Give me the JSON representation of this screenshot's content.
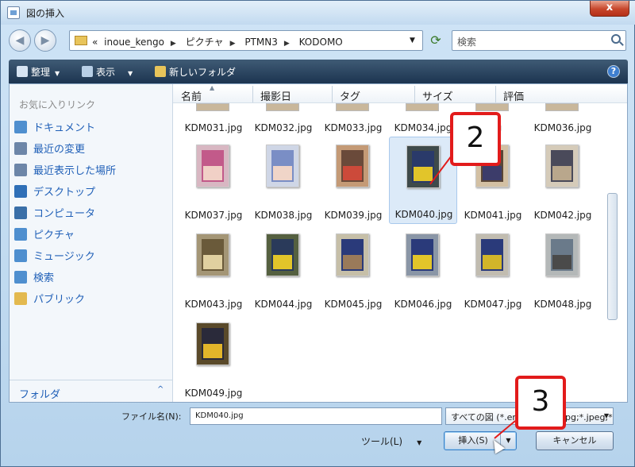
{
  "window": {
    "title": "図の挿入",
    "close_label": "x"
  },
  "address": {
    "crumbs": [
      "«",
      "inoue_kengo",
      "ピクチャ",
      "PTMN3",
      "KODOMO"
    ],
    "search_placeholder": "検索"
  },
  "toolbar": {
    "organize": "整理",
    "views": "表示",
    "new_folder": "新しいフォルダ",
    "help": "?"
  },
  "sidebar": {
    "favorites_header": "お気に入りリンク",
    "items": [
      {
        "label": "ドキュメント",
        "icon": "documents-icon",
        "color": "#4f8fcf"
      },
      {
        "label": "最近の変更",
        "icon": "recent-changes-icon",
        "color": "#6d86a8"
      },
      {
        "label": "最近表示した場所",
        "icon": "recent-places-icon",
        "color": "#6d86a8"
      },
      {
        "label": "デスクトップ",
        "icon": "desktop-icon",
        "color": "#2f6fb7"
      },
      {
        "label": "コンピュータ",
        "icon": "computer-icon",
        "color": "#3a6fa8"
      },
      {
        "label": "ピクチャ",
        "icon": "pictures-icon",
        "color": "#4f8fcf"
      },
      {
        "label": "ミュージック",
        "icon": "music-icon",
        "color": "#4f8fcf"
      },
      {
        "label": "検索",
        "icon": "search-folder-icon",
        "color": "#4f8fcf"
      },
      {
        "label": "パブリック",
        "icon": "public-folder-icon",
        "color": "#e3b94f"
      }
    ],
    "folders_label": "フォルダ",
    "folders_chevron": "^"
  },
  "columns": [
    "名前",
    "撮影日",
    "タグ",
    "サイズ",
    "評価"
  ],
  "files": {
    "top_row": [
      "KDM031.jpg",
      "KDM032.jpg",
      "KDM033.jpg",
      "KDM034.jpg",
      ".jpg",
      "KDM036.jpg"
    ],
    "rows": [
      [
        {
          "name": "KDM037.jpg",
          "bg": "#d8b7c2",
          "c1": "#c25a8a",
          "c2": "#f1d0c6"
        },
        {
          "name": "KDM038.jpg",
          "bg": "#cfd6e6",
          "c1": "#7a8ec5",
          "c2": "#f0d5c8"
        },
        {
          "name": "KDM039.jpg",
          "bg": "#c49a76",
          "c1": "#6a4a3a",
          "c2": "#cc4a3a"
        },
        {
          "name": "KDM040.jpg",
          "bg": "#3e4a4a",
          "c1": "#2a3a6a",
          "c2": "#e2c52a",
          "selected": true
        },
        {
          "name": "KDM041.jpg",
          "bg": "#d3c0a3",
          "c1": "#5a4636",
          "c2": "#3c3c6a"
        },
        {
          "name": "KDM042.jpg",
          "bg": "#d5cbb9",
          "c1": "#4a4a5a",
          "c2": "#b9a78c"
        }
      ],
      [
        {
          "name": "KDM043.jpg",
          "bg": "#a49676",
          "c1": "#6a5a3a",
          "c2": "#e0d0a0"
        },
        {
          "name": "KDM044.jpg",
          "bg": "#556040",
          "c1": "#2a3a5a",
          "c2": "#e2c52a"
        },
        {
          "name": "KDM045.jpg",
          "bg": "#c6bfa8",
          "c1": "#2a3a7a",
          "c2": "#9a7a5a"
        },
        {
          "name": "KDM046.jpg",
          "bg": "#8a96a6",
          "c1": "#2a3a7a",
          "c2": "#e2c52a"
        },
        {
          "name": "KDM047.jpg",
          "bg": "#c1bcb0",
          "c1": "#2a3a7a",
          "c2": "#d2b52a"
        },
        {
          "name": "KDM048.jpg",
          "bg": "#b4b8b8",
          "c1": "#6a7a8a",
          "c2": "#4a4a4a"
        }
      ],
      [
        {
          "name": "KDM049.jpg",
          "bg": "#5a4a2a",
          "c1": "#2a2a3a",
          "c2": "#e2b52a"
        }
      ]
    ]
  },
  "footer": {
    "filename_label": "ファイル名(N):",
    "filename_value": "KDM040.jpg",
    "filetype_value": "すべての図 (*.emf;*.wmf;*.jpg;*.jpeg;*.jfif;*.jpe",
    "tools_label": "ツール(L)",
    "insert_label": "挿入(S)",
    "cancel_label": "キャンセル"
  },
  "callouts": [
    "2",
    "3"
  ],
  "colors": {
    "accent": "#e21b1b",
    "link": "#1f5fb7",
    "toolbar": "#1c3450"
  }
}
